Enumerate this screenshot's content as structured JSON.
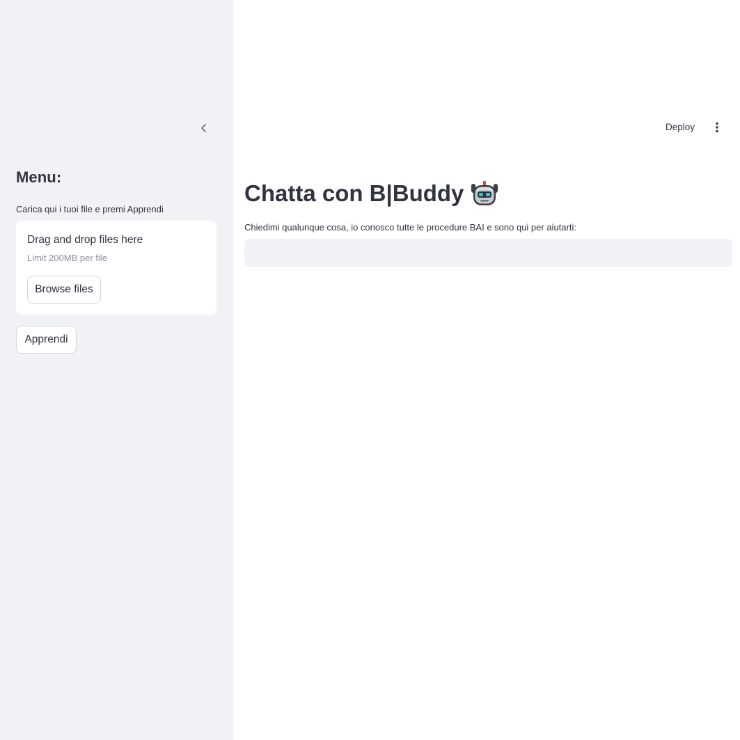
{
  "sidebar": {
    "title": "Menu:",
    "caption": "Carica qui i tuoi file e premi Apprendi",
    "uploader": {
      "title": "Drag and drop files here",
      "limit": "Limit 200MB per file",
      "browse_label": "Browse files"
    },
    "apprendi_label": "Apprendi"
  },
  "header": {
    "deploy_label": "Deploy"
  },
  "main": {
    "title": "Chatta con B|Buddy",
    "title_icon": "robot-face-icon",
    "subtitle": "Chiedimi qualunque cosa, io conosco tutte le procedure BAI e sono qui per aiutarti:",
    "chat_input": {
      "value": "",
      "placeholder": ""
    }
  },
  "colors": {
    "sidebar_bg": "#f0f2f6",
    "text": "#31333f",
    "muted_text": "#8d8f97",
    "input_bg": "#f0f2f6",
    "button_border": "#d3d5db"
  }
}
